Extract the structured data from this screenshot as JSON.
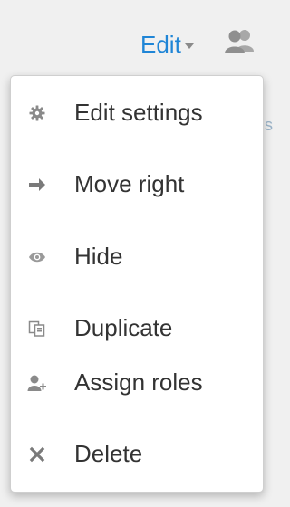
{
  "toggle": {
    "label": "Edit",
    "caret_icon": "caret-down-icon",
    "users_icon": "users-icon"
  },
  "edge_text": "s",
  "menu": {
    "items": [
      {
        "label": "Edit settings",
        "icon": "gear-icon"
      },
      {
        "label": "Move right",
        "icon": "arrow-right-icon"
      },
      {
        "label": "Hide",
        "icon": "eye-icon"
      },
      {
        "label": "Duplicate",
        "icon": "duplicate-icon"
      },
      {
        "label": "Assign roles",
        "icon": "user-plus-icon"
      },
      {
        "label": "Delete",
        "icon": "close-icon"
      }
    ]
  },
  "colors": {
    "link": "#1f85d6",
    "text": "#333333",
    "icon": "#8a8a8a",
    "background": "#f0f0f0",
    "menu_bg": "#ffffff"
  }
}
